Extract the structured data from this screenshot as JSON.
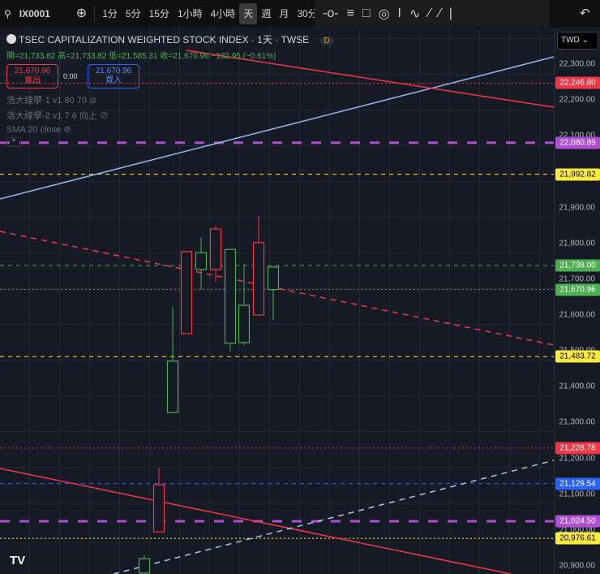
{
  "toolbar": {
    "symbol": "IX0001",
    "timeframes": [
      "1分",
      "5分",
      "15分",
      "1小時",
      "4小時",
      "天",
      "週",
      "月",
      "30分"
    ],
    "active": "天",
    "currency": "TWD"
  },
  "legend": {
    "title": "TSEC CAPITALIZATION WEIGHTED STOCK INDEX · 1天 · TWSE",
    "badge": "D",
    "ohlc": "開=21,733.82 高=21,733.82 低=21,585.31 收=21,670.96 −132.95 (−0.61%)",
    "sell_price": "21,670.96",
    "sell_label": "賣出",
    "spread": "0.00",
    "buy_price": "21,670.96",
    "buy_label": "買入",
    "indicators": [
      "浩大線學-1 v1 80 70",
      "浩大線學-2 v1 7 6 向上",
      "SMA 20 close"
    ]
  },
  "axis": {
    "ticks": [
      "22,300.00",
      "22,200.00",
      "22,100.00",
      "21,900.00",
      "21,800.00",
      "21,700.00",
      "21,600.00",
      "21,500.00",
      "21,400.00",
      "21,300.00",
      "21,200.00",
      "21,100.00",
      "21,000.00",
      "20,900.00"
    ]
  },
  "price_lines": [
    {
      "label": "22,246.80",
      "price": 22246.8,
      "color": "#f23645",
      "style": "dotted"
    },
    {
      "label": "22,080.89",
      "price": 22080.89,
      "color": "#b04fd6",
      "style": "dash-thick"
    },
    {
      "label": "21,992.82",
      "price": 21992.82,
      "color": "#ffeb3b",
      "style": "dashed"
    },
    {
      "label": "21,738.00",
      "price": 21738.0,
      "color": "#4caf50",
      "style": "dashed"
    },
    {
      "label": "21,670.96",
      "price": 21670.96,
      "color": "#787b86",
      "style": "dotted",
      "tag": "#4caf50"
    },
    {
      "label": "21,483.72",
      "price": 21483.72,
      "color": "#ffeb3b",
      "style": "dashed"
    },
    {
      "label": "21,228.78",
      "price": 21228.78,
      "color": "#f23645",
      "style": "dotted"
    },
    {
      "label": "21,129.54",
      "price": 21129.54,
      "color": "#2962ff",
      "style": "dashed"
    },
    {
      "label": "21,024.50",
      "price": 21024.5,
      "color": "#b04fd6",
      "style": "dash-thick"
    },
    {
      "label": "20,976.61",
      "price": 20976.61,
      "color": "#ffeb3b",
      "style": "dotted"
    }
  ],
  "chart_data": {
    "type": "candlestick",
    "up_color": "#f23645",
    "down_color": "#4caf50",
    "candles": [
      {
        "o": 20920,
        "h": 20930,
        "c": 20880,
        "l": 20880
      },
      {
        "o": 20995,
        "h": 21174,
        "c": 21126,
        "l": 20995
      },
      {
        "o": 21471,
        "h": 21623,
        "c": 21328,
        "l": 21328
      },
      {
        "o": 21548,
        "h": 21777,
        "c": 21777,
        "l": 21548
      },
      {
        "o": 21774,
        "h": 21817,
        "c": 21727,
        "l": 21670
      },
      {
        "o": 21727,
        "h": 21849,
        "c": 21840,
        "l": 21693
      },
      {
        "o": 21783,
        "h": 21783,
        "c": 21521,
        "l": 21498
      },
      {
        "o": 21627,
        "h": 21743,
        "c": 21523,
        "l": 21516
      },
      {
        "o": 21600,
        "h": 21876,
        "c": 21802,
        "l": 21600
      },
      {
        "o": 21733.82,
        "h": 21733.82,
        "c": 21670.96,
        "l": 21585.31
      }
    ]
  }
}
